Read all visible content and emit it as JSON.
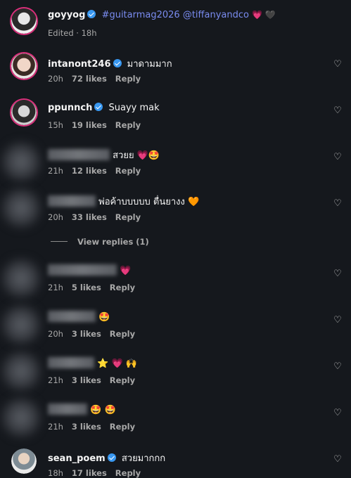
{
  "caption": {
    "username": "goyyog",
    "text": "#guitarmag2026 @tiffanyandco",
    "emoji": "💗 🖤",
    "edited": "Edited · 18h"
  },
  "comments": [
    {
      "username": "intanont246",
      "verified": true,
      "text": "มาดามมาก",
      "time": "20h",
      "likes": "72 likes",
      "reply": "Reply"
    },
    {
      "username": "ppunnch",
      "verified": true,
      "text": "Suayy mak",
      "time": "15h",
      "likes": "19 likes",
      "reply": "Reply"
    },
    {
      "username": "",
      "text": "สวยย 💗🤩",
      "time": "21h",
      "likes": "12 likes",
      "reply": "Reply"
    },
    {
      "username": "",
      "text": "พ่อค้าบบบบบ ตื่นยางง 🧡",
      "time": "20h",
      "likes": "33 likes",
      "reply": "Reply"
    },
    {
      "username": "",
      "text": "💗",
      "time": "21h",
      "likes": "5 likes",
      "reply": "Reply"
    },
    {
      "username": "",
      "text": "🤩",
      "time": "20h",
      "likes": "3 likes",
      "reply": "Reply"
    },
    {
      "username": "",
      "text": "⭐ 💗 🙌",
      "time": "21h",
      "likes": "3 likes",
      "reply": "Reply"
    },
    {
      "username": "",
      "text": "🤩 🤩",
      "time": "21h",
      "likes": "3 likes",
      "reply": "Reply"
    },
    {
      "username": "sean_poem",
      "verified": true,
      "text": "สวยมากกก",
      "time": "18h",
      "likes": "17 likes",
      "reply": "Reply"
    }
  ],
  "view_replies": "View replies (1)",
  "icons": {
    "heart": "heart-outline-icon",
    "verified": "verified-badge-icon"
  },
  "colors": {
    "background": "#15181d",
    "verified": "#3897f0",
    "tag": "#7a8cf0",
    "ring": "#d92f7a"
  }
}
